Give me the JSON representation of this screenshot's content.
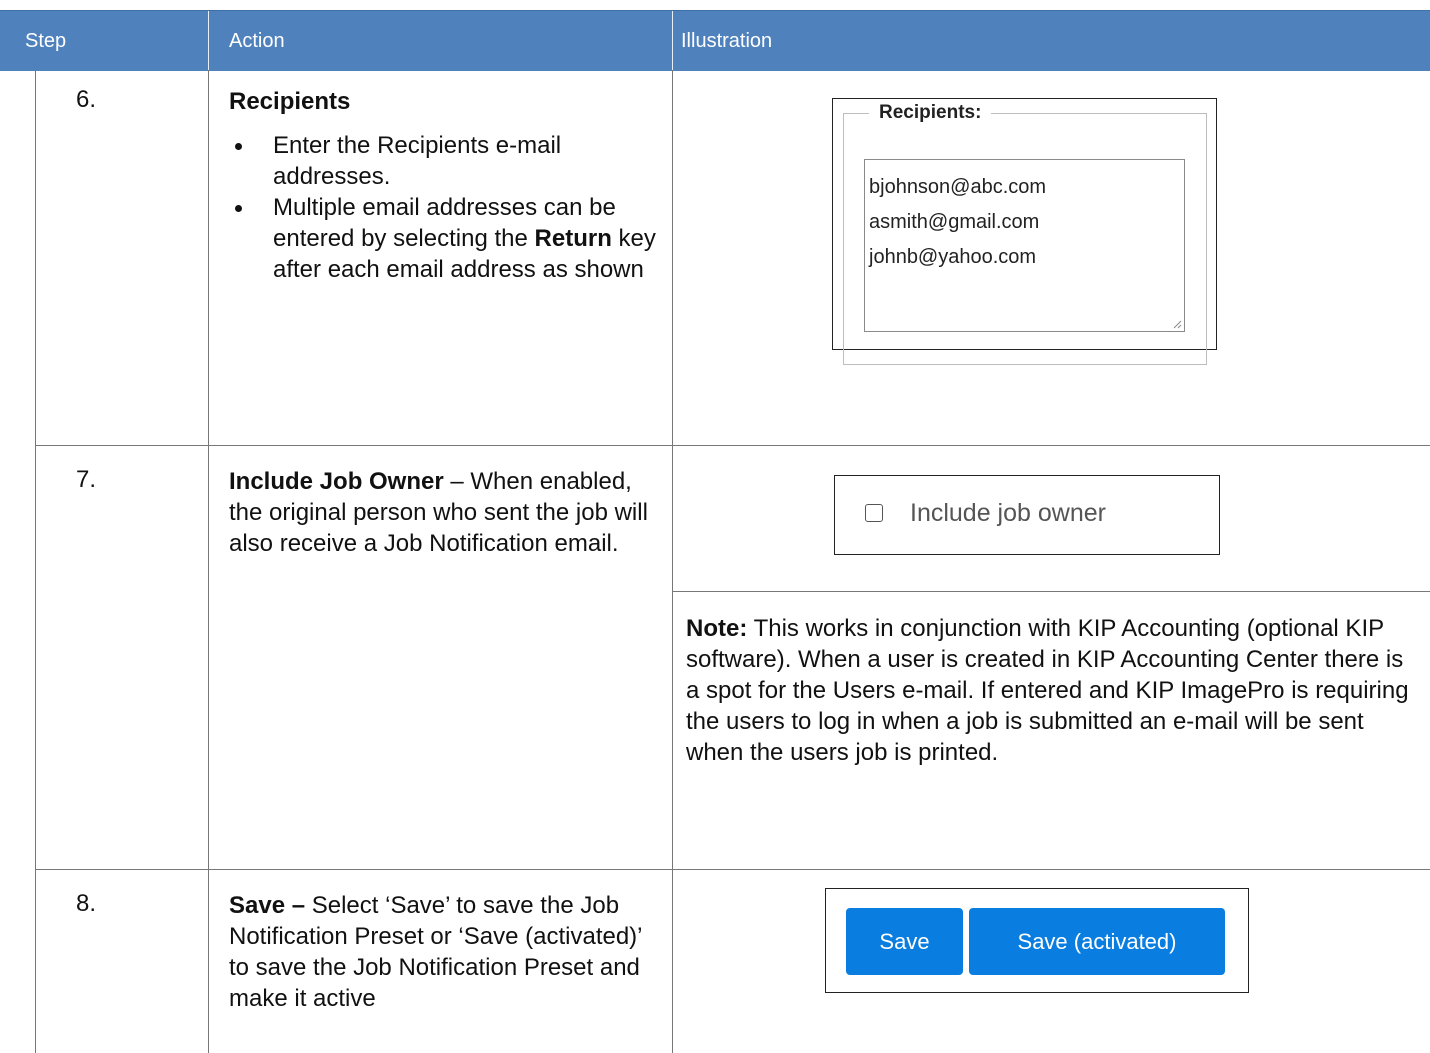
{
  "table": {
    "headers": {
      "step": "Step",
      "action": "Action",
      "illustration": "Illustration"
    },
    "rows": [
      {
        "step": "6.",
        "title": "Recipients",
        "bullets": [
          "Enter the Recipients e-mail addresses.",
          {
            "pre": "Multiple email addresses can be entered by selecting the ",
            "bold": "Return",
            "post": " key after each email address as shown"
          }
        ],
        "illustration": {
          "legend": "Recipients:",
          "emails": [
            "bjohnson@abc.com",
            "asmith@gmail.com",
            "johnb@yahoo.com"
          ]
        }
      },
      {
        "step": "7.",
        "title": "Include Job Owner",
        "text": " – When enabled, the original person who sent the job will also receive a Job Notification email.",
        "illustration": {
          "checkbox_label": "Include job owner",
          "checked": false
        },
        "note": {
          "label": "Note:",
          "text": " This works in conjunction with KIP Accounting (optional KIP software). When a user is created in KIP Accounting Center there is a spot for the Users e-mail. If entered and KIP ImagePro is requiring the users to log in when a job is submitted an e-mail will be sent when the users job is printed."
        }
      },
      {
        "step": "8.",
        "title": "Save –",
        "text": " Select ‘Save’ to save the Job Notification Preset or ‘Save (activated)’ to save the Job Notification Preset and make it active",
        "illustration": {
          "buttons": [
            "Save",
            "Save (activated)"
          ],
          "button_color": "#0a7ee0"
        }
      }
    ]
  },
  "colors": {
    "header_bg": "#4f81bd",
    "header_text": "#ffffff"
  }
}
